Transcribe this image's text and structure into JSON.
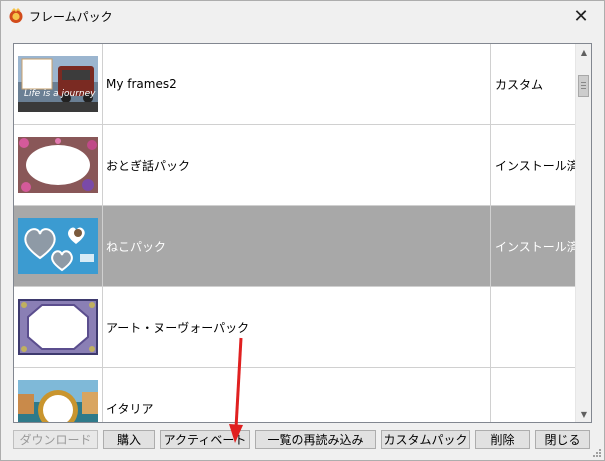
{
  "window": {
    "title": "フレームパック",
    "close_icon": "close-icon",
    "app_icon": "frame-pack-app-icon"
  },
  "list": {
    "rows": [
      {
        "thumb_text": "Life is a journey",
        "name": "My frames2",
        "status": "カスタム",
        "selected": false
      },
      {
        "name": "おとぎ話パック",
        "status": "インストール済み",
        "selected": false
      },
      {
        "name": "ねこパック",
        "status": "インストール済み",
        "selected": true
      },
      {
        "name": "アート・ヌーヴォーパック",
        "status": "",
        "selected": false
      },
      {
        "name": "イタリア",
        "status": "",
        "selected": false
      }
    ]
  },
  "buttons": {
    "download": "ダウンロード",
    "purchase": "購入",
    "activate": "アクティベート",
    "reload_list": "一覧の再読み込み",
    "custom_pack": "カスタムパック",
    "delete": "削除",
    "close": "閉じる"
  },
  "colors": {
    "selected_row": "#a8a8a8",
    "annotation_arrow": "#e02020"
  }
}
